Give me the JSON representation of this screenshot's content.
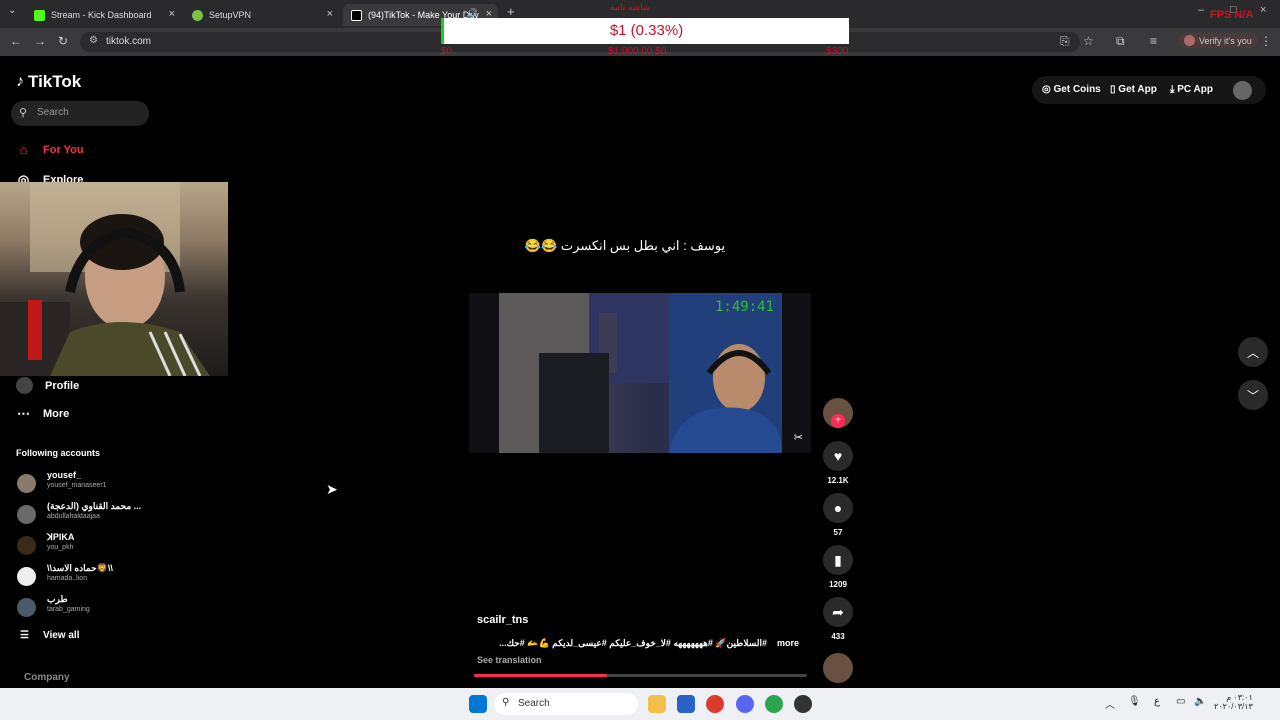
{
  "browser": {
    "tabs": [
      {
        "label": "Stream - Kick Dashboard",
        "active": false
      },
      {
        "label": "SetupVPN",
        "active": false
      },
      {
        "label": "(94)TikTok - Make Your Day",
        "active": true
      }
    ],
    "url": "tikotok.com",
    "url_display": "tiktok.com",
    "verify_label": "Verify it's you"
  },
  "overlay": {
    "donation_title": "شاشة ثانية",
    "donation_value": "$1 (0.33%)",
    "left_value": "$0",
    "mid_value": "$1,000.00 $0",
    "right_value": "$300",
    "fps_label": "FPS N/A"
  },
  "tiktok": {
    "logo": "TikTok",
    "search_placeholder": "Search",
    "nav": [
      {
        "label": "For You",
        "active": true
      },
      {
        "label": "Explore",
        "active": false
      },
      {
        "label": "Profile",
        "active": false
      },
      {
        "label": "More",
        "active": false
      }
    ],
    "following_title": "Following accounts",
    "following": [
      {
        "name": "yousef_",
        "handle": "yousef_manaseer1"
      },
      {
        "name": "محمد القناوي (الدعجة) ...",
        "handle": "abdullahaldaajaa"
      },
      {
        "name": "ꓘPIKA",
        "handle": "you_pkh"
      },
      {
        "name": "\\\\حماده الاسد🦁\\\\",
        "handle": "hamada..lion"
      },
      {
        "name": "طرب",
        "handle": "tarab_gaming"
      }
    ],
    "view_all": "View all",
    "company": "Company",
    "top_buttons": {
      "coins": "Get Coins",
      "app": "Get App",
      "pc": "PC App"
    },
    "video": {
      "caption_top": "يوسف : اني بطل بس انكسرت 😂😂",
      "timer": "1:49:41",
      "author": "scailr_tns",
      "description": "#السلاطين🚀 #هههههههه #لا_خوف_عليكم #عيسى_لديكم 💪🫴 #حك...",
      "more": "more",
      "see_translation": "See translation",
      "progress": 0.4
    },
    "actions": {
      "likes": "12.1K",
      "comments": "57",
      "saves": "1209",
      "shares": "433"
    }
  },
  "taskbar": {
    "search": "Search",
    "lang": "ع",
    "time": "٠٣:٠١ م",
    "date": "٢٠٢٠/٠٣/١٣"
  }
}
